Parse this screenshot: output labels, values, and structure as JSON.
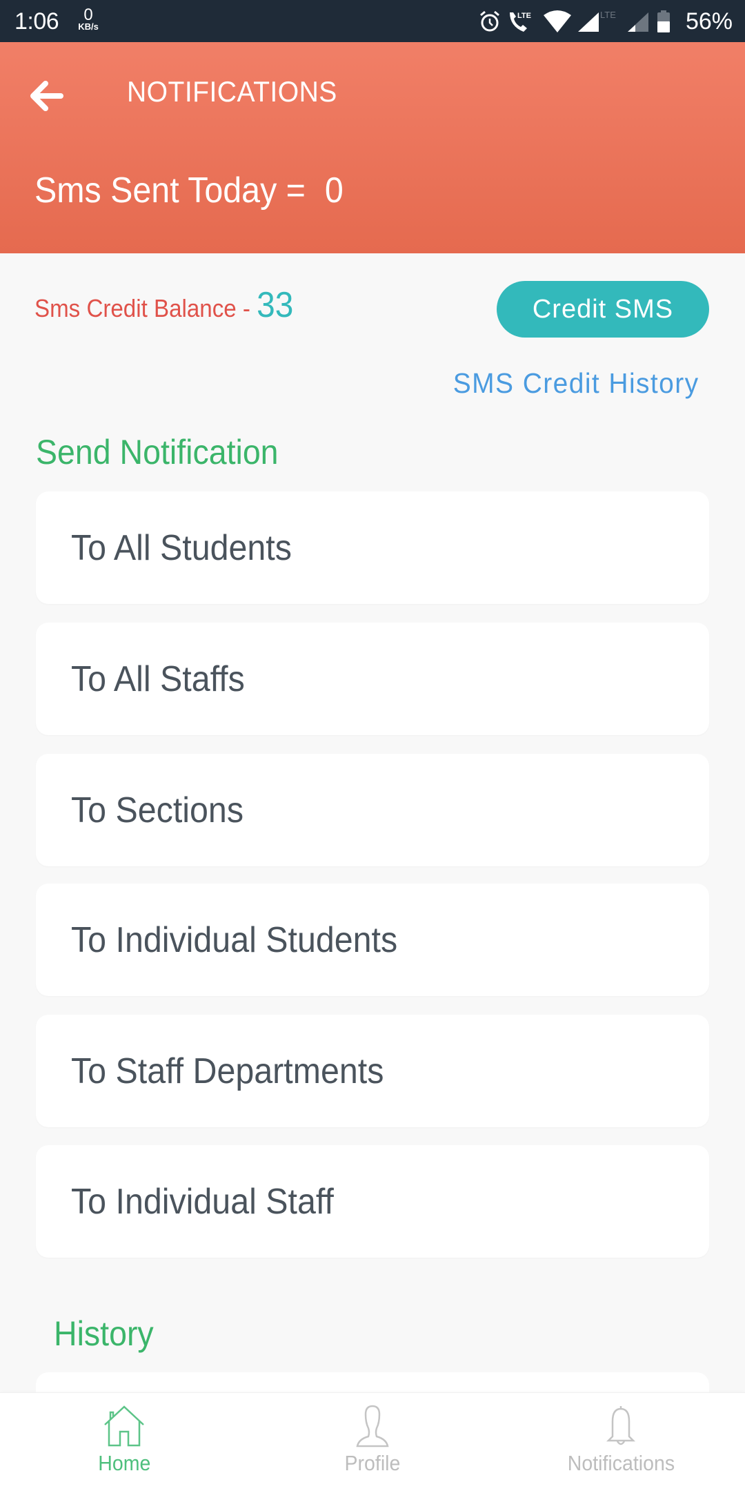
{
  "status_bar": {
    "time": "1:06",
    "net_speed_value": "0",
    "net_speed_unit": "KB/s",
    "icons": [
      "alarm-icon",
      "volte-call-icon",
      "wifi-icon",
      "signal-lte-icon",
      "signal-icon",
      "battery-icon"
    ],
    "lte_label": "LTE",
    "battery_percent": "56%"
  },
  "header": {
    "title": "NOTIFICATIONS",
    "back_icon": "arrow-left-icon",
    "sms_sent_label": "Sms Sent Today =",
    "sms_sent_value": "0"
  },
  "credit": {
    "balance_label": "Sms Credit Balance - ",
    "balance_value": "33",
    "credit_button": "Credit SMS",
    "history_link": "SMS Credit History"
  },
  "send_notification": {
    "title": "Send Notification",
    "items": [
      {
        "label": "To All Students"
      },
      {
        "label": "To All Staffs"
      },
      {
        "label": "To Sections"
      },
      {
        "label": "To Individual Students"
      },
      {
        "label": "To Staff Departments"
      },
      {
        "label": "To Individual Staff"
      }
    ]
  },
  "history": {
    "title": "History"
  },
  "bottom_nav": {
    "items": [
      {
        "label": "Home",
        "icon": "home-icon",
        "active": true
      },
      {
        "label": "Profile",
        "icon": "profile-icon",
        "active": false
      },
      {
        "label": "Notifications",
        "icon": "bell-icon",
        "active": false
      }
    ]
  },
  "colors": {
    "header_top": "#f17f67",
    "header_bottom": "#e56a4f",
    "accent_teal": "#33b9bb",
    "balance_label_red": "#e0524a",
    "link_blue": "#4a9be0",
    "section_green": "#3bb56a",
    "status_bar": "#1f2b38"
  }
}
